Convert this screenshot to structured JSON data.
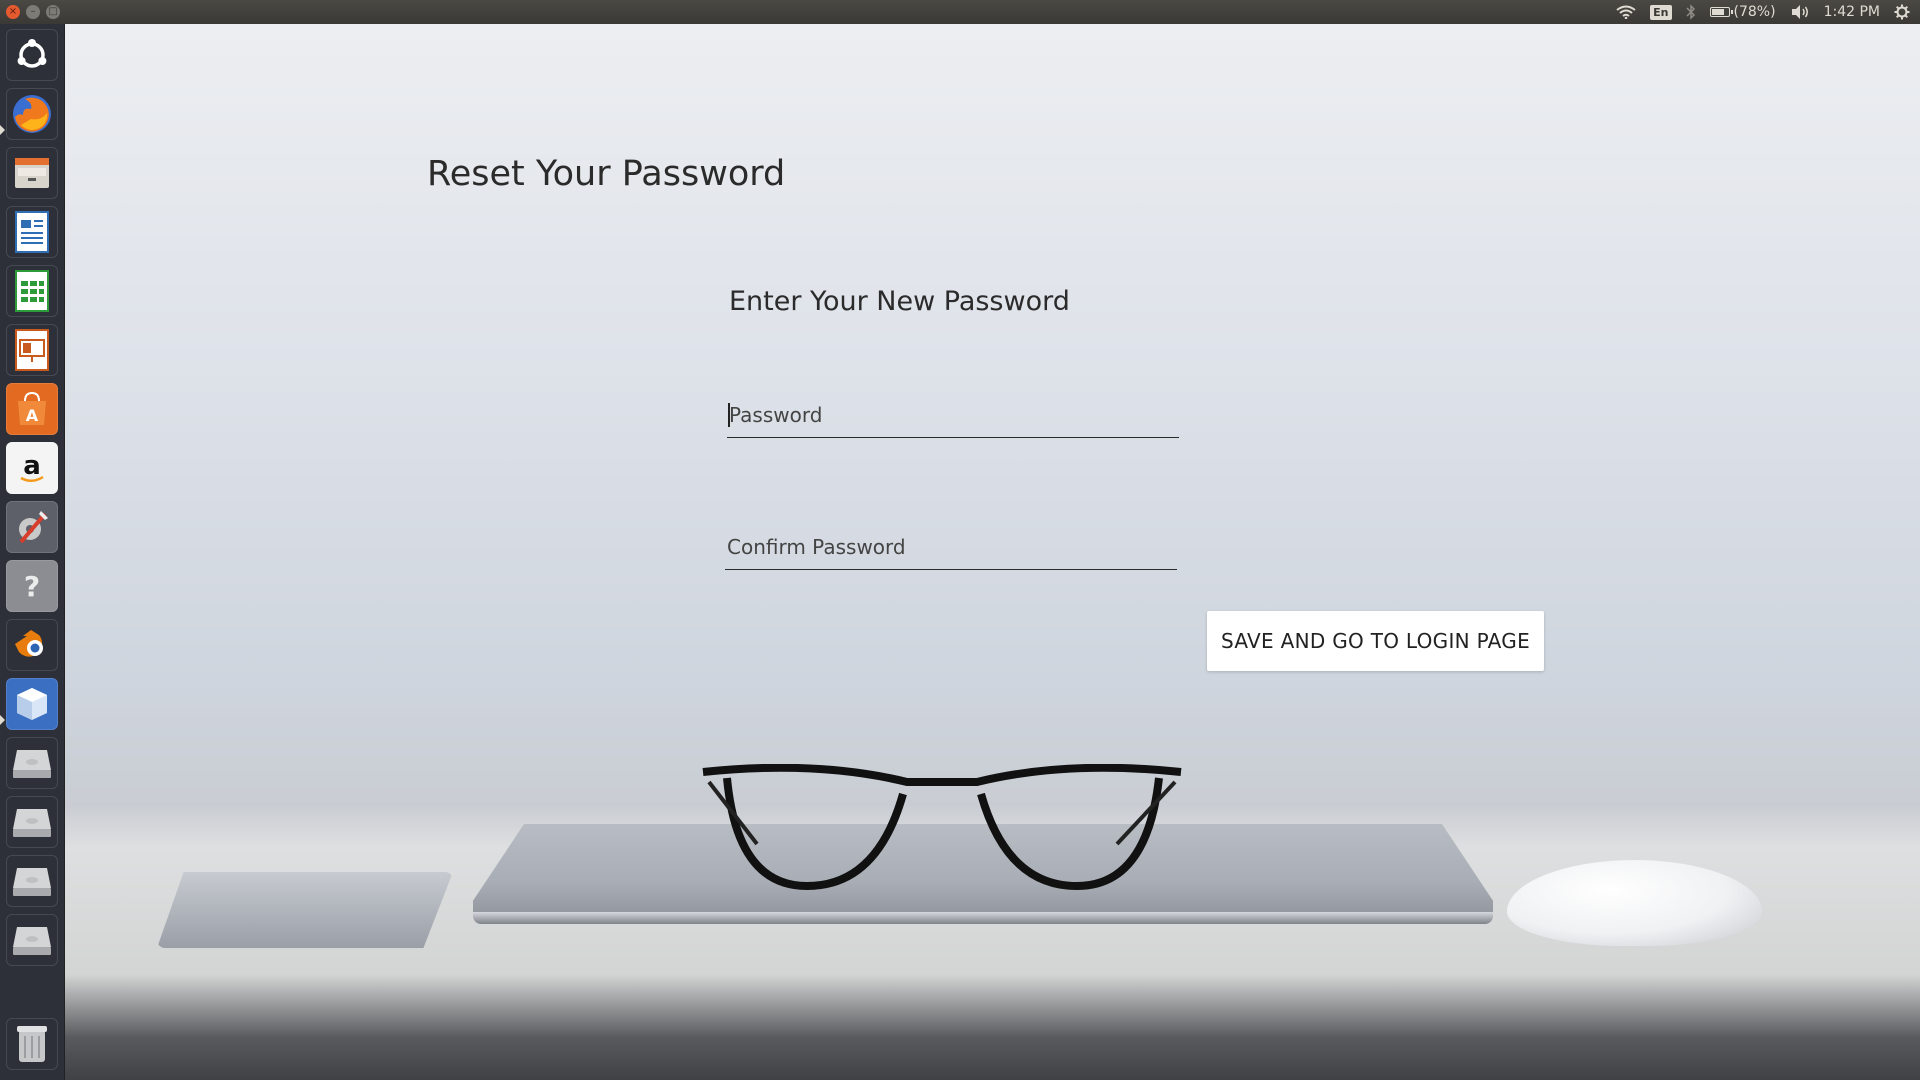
{
  "window_controls": {
    "close": "×",
    "minimize": "–",
    "maximize": "□"
  },
  "top_panel": {
    "language": "En",
    "battery_text": "(78%)",
    "battery_level": 0.78,
    "time": "1:42 PM"
  },
  "launcher": {
    "items": [
      {
        "name": "ubuntu-dash",
        "color": "#6a6d75"
      },
      {
        "name": "firefox",
        "color": "#e8571c"
      },
      {
        "name": "files",
        "color": "#8a7f70"
      },
      {
        "name": "libreoffice-writer",
        "color": "#2f6db5"
      },
      {
        "name": "libreoffice-calc",
        "color": "#2e9b3a"
      },
      {
        "name": "libreoffice-impress",
        "color": "#c85a1e"
      },
      {
        "name": "ubuntu-software",
        "color": "#e26a21"
      },
      {
        "name": "amazon",
        "color": "#f2f2f2"
      },
      {
        "name": "system-settings",
        "color": "#6f7178"
      },
      {
        "name": "help",
        "color": "#7d7f85"
      },
      {
        "name": "blender",
        "color": "#e87d0d"
      },
      {
        "name": "virtualbox",
        "color": "#2d64b3"
      },
      {
        "name": "drive",
        "color": "#b9babc"
      },
      {
        "name": "drive",
        "color": "#b9babc"
      },
      {
        "name": "drive",
        "color": "#b9babc"
      },
      {
        "name": "drive",
        "color": "#b9babc"
      },
      {
        "name": "trash",
        "color": "#9b9c9e"
      }
    ]
  },
  "page": {
    "title": "Reset Your Password",
    "form_heading": "Enter Your New Password",
    "password_placeholder": "Password",
    "password_value": "",
    "confirm_placeholder": "Confirm Password",
    "confirm_value": "",
    "save_button": "SAVE AND GO TO LOGIN PAGE"
  }
}
